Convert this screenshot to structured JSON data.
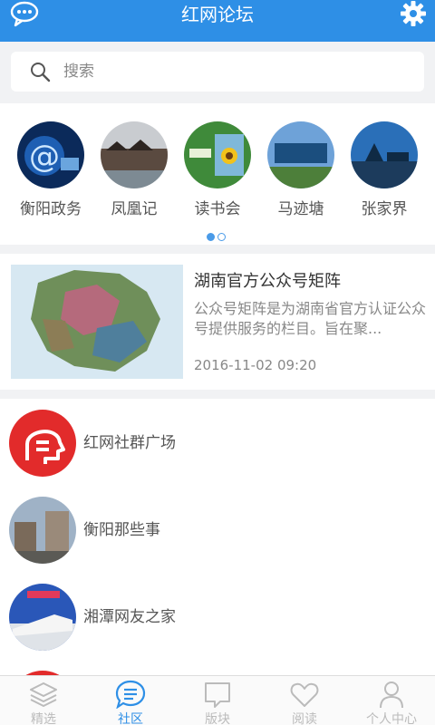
{
  "header": {
    "title": "红网论坛"
  },
  "search": {
    "placeholder": "搜索"
  },
  "categories": [
    {
      "label": "衡阳政务"
    },
    {
      "label": "凤凰记"
    },
    {
      "label": "读书会"
    },
    {
      "label": "马迹塘"
    },
    {
      "label": "张家界"
    }
  ],
  "pager": {
    "pages": 2,
    "current": 1
  },
  "feature": {
    "title": "湖南官方公众号矩阵",
    "description": "公众号矩阵是为湖南省官方认证公众号提供服务的栏目。旨在聚...",
    "time": "2016-11-02 09:20"
  },
  "communities": [
    {
      "name": "红网社群广场"
    },
    {
      "name": "衡阳那些事"
    },
    {
      "name": "湘潭网友之家"
    }
  ],
  "tabs": [
    {
      "label": "精选",
      "icon": "layers-icon"
    },
    {
      "label": "社区",
      "icon": "chat-bubble-icon"
    },
    {
      "label": "版块",
      "icon": "board-icon"
    },
    {
      "label": "阅读",
      "icon": "heart-icon"
    },
    {
      "label": "个人中心",
      "icon": "person-icon"
    }
  ],
  "colors": {
    "accent": "#2e8fe6",
    "inactive": "#bbbbbb"
  }
}
